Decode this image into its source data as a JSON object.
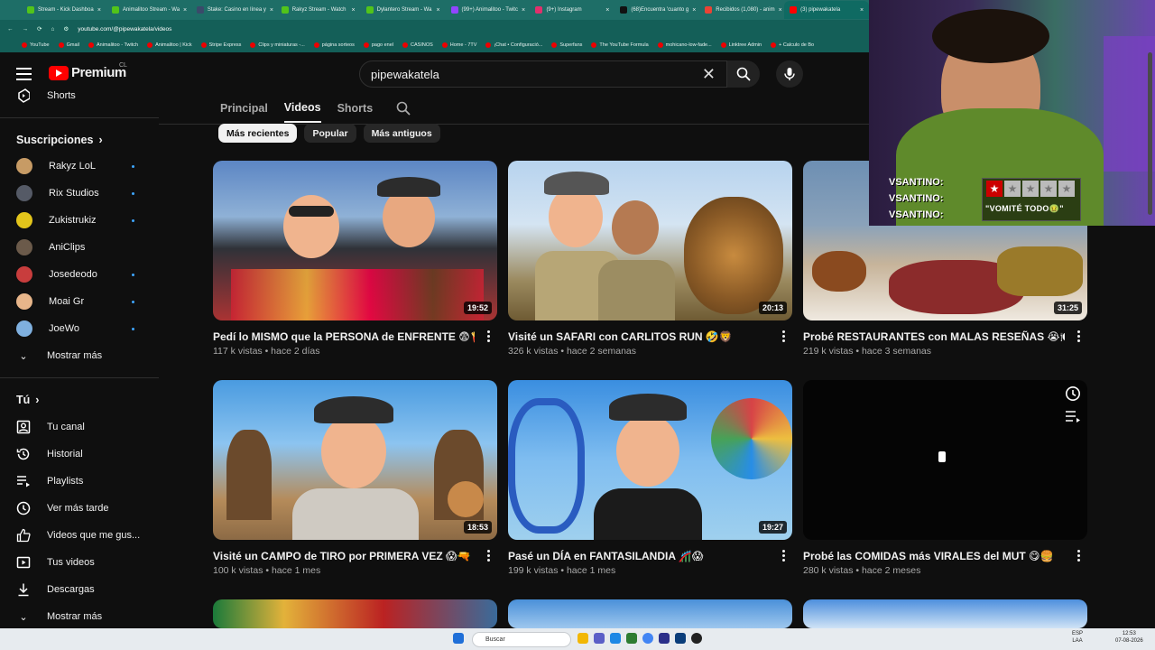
{
  "browser": {
    "tabs": [
      {
        "label": "Stream - Kick Dashboa",
        "fav": "#52c41a"
      },
      {
        "label": "Animalitoo Stream - Wa",
        "fav": "#52c41a"
      },
      {
        "label": "Stake: Casino en línea y",
        "fav": "#3a4a6a"
      },
      {
        "label": "Rakyz Stream - Watch",
        "fav": "#52c41a"
      },
      {
        "label": "Dylantero Stream - Wa",
        "fav": "#52c41a"
      },
      {
        "label": "(99+) Animalitoo - Twitc",
        "fav": "#9146ff"
      },
      {
        "label": "(9+) Instagram",
        "fav": "#e1306c"
      },
      {
        "label": "(68)Encuentra 'cuanto g",
        "fav": "#111111"
      },
      {
        "label": "Recibidos (1,080) - anim",
        "fav": "#ea4335"
      },
      {
        "label": "(3) pipewakatela",
        "fav": "#ff0000"
      }
    ],
    "address": "youtube.com/@pipewakatela/videos",
    "bookmarks": [
      "YouTube",
      "Gmail",
      "Animalitoo - Twitch",
      "Animalitoo | Kick",
      "Stripe Express",
      "Clips y miniaturas -...",
      "página sorteos",
      "pago enel",
      "CASINOS",
      "Home - 7TV",
      "¡Chat • Configuració...",
      "Superfans",
      "The YouTube Formula",
      "mohicano-low-fade...",
      "Linktree Admin",
      "+ Calculo de Bo"
    ]
  },
  "youtube": {
    "logo_word": "Premium",
    "country": "CL",
    "search_value": "pipewakatela"
  },
  "sidebar": {
    "shorts": "Shorts",
    "subs_heading": "Suscripciones",
    "subscriptions": [
      {
        "name": "Rakyz LoL",
        "color": "#c79b65",
        "new": true
      },
      {
        "name": "Rix Studios",
        "color": "#555a66",
        "new": true
      },
      {
        "name": "Zukistrukiz",
        "color": "#e3c51b",
        "new": true
      },
      {
        "name": "AniClips",
        "color": "#6b5a4a",
        "new": false
      },
      {
        "name": "Josedeodo",
        "color": "#c83d3d",
        "new": true
      },
      {
        "name": "Moai Gr",
        "color": "#e7b58a",
        "new": true
      },
      {
        "name": "JoeWo",
        "color": "#7fb0df",
        "new": true
      }
    ],
    "show_more_1": "Mostrar más",
    "you_heading": "Tú",
    "you_items": [
      {
        "label": "Tu canal",
        "icon": "account-box-icon"
      },
      {
        "label": "Historial",
        "icon": "history-icon"
      },
      {
        "label": "Playlists",
        "icon": "playlists-icon"
      },
      {
        "label": "Ver más tarde",
        "icon": "watch-later-icon"
      },
      {
        "label": "Videos que me gus...",
        "icon": "like-icon"
      },
      {
        "label": "Tus videos",
        "icon": "your-videos-icon"
      },
      {
        "label": "Descargas",
        "icon": "download-icon"
      }
    ],
    "show_more_2": "Mostrar más"
  },
  "channel_tabs": [
    "Principal",
    "Videos",
    "Shorts"
  ],
  "active_tab": "Videos",
  "chips": [
    "Más recientes",
    "Popular",
    "Más antiguos"
  ],
  "videos": [
    {
      "title": "Pedí lo MISMO que la PERSONA de ENFRENTE 😨🍟",
      "meta": "117 k vistas • hace 2 días",
      "duration": "19:52"
    },
    {
      "title": "Visité un SAFARI con CARLITOS RUN 🤣🦁",
      "meta": "326 k vistas • hace 2 semanas",
      "duration": "20:13"
    },
    {
      "title": "Probé RESTAURANTES con MALAS RESEÑAS 😭🍽️",
      "meta": "219 k vistas • hace 3 semanas",
      "duration": "31:25"
    },
    {
      "title": "Visité un CAMPO de TIRO por PRIMERA VEZ 😱🔫",
      "meta": "100 k vistas • hace 1 mes",
      "duration": "18:53"
    },
    {
      "title": "Pasé un DÍA en FANTASILANDIA 🎢😱",
      "meta": "199 k vistas • hace 1 mes",
      "duration": "19:27"
    },
    {
      "title": "Probé las COMIDAS más VIRALES del MUT 😋🍔",
      "meta": "280 k vistas • hace 2 meses",
      "duration": ""
    }
  ],
  "overlay": {
    "vsantino": [
      "VSANTINO:",
      "VSANTINO:",
      "VSANTINO:"
    ],
    "rating_stars": 1,
    "rating_max": 5,
    "quote": "\"VOMITÉ TODO🤢\""
  },
  "taskbar": {
    "search": "Buscar",
    "lang": "ESP",
    "region": "LAA",
    "time": "12:53",
    "date": "07-08-2026"
  }
}
